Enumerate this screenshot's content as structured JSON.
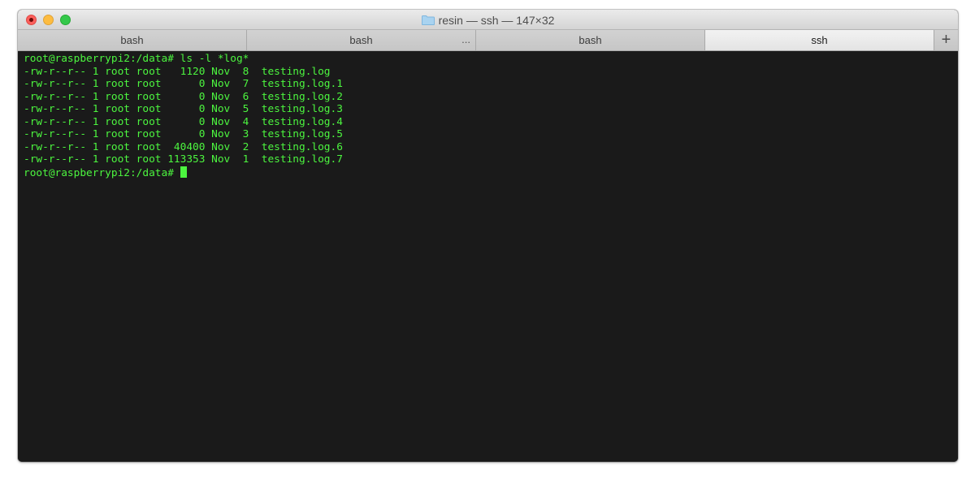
{
  "window": {
    "title": "resin — ssh — 147×32",
    "title_icon": "folder-icon"
  },
  "tabs": [
    {
      "label": "bash",
      "active": false
    },
    {
      "label": "bash",
      "active": false,
      "indicator": "..."
    },
    {
      "label": "bash",
      "active": false
    },
    {
      "label": "ssh",
      "active": true
    }
  ],
  "new_tab_label": "+",
  "terminal": {
    "lines": [
      "root@raspberrypi2:/data# ls -l *log*",
      "-rw-r--r-- 1 root root   1120 Nov  8  testing.log",
      "-rw-r--r-- 1 root root      0 Nov  7  testing.log.1",
      "-rw-r--r-- 1 root root      0 Nov  6  testing.log.2",
      "-rw-r--r-- 1 root root      0 Nov  5  testing.log.3",
      "-rw-r--r-- 1 root root      0 Nov  4  testing.log.4",
      "-rw-r--r-- 1 root root      0 Nov  3  testing.log.5",
      "-rw-r--r-- 1 root root  40400 Nov  2  testing.log.6",
      "-rw-r--r-- 1 root root 113353 Nov  1  testing.log.7"
    ],
    "prompt": "root@raspberrypi2:/data# ",
    "text_color": "#4cf53f",
    "background_color": "#1a1a1a"
  }
}
